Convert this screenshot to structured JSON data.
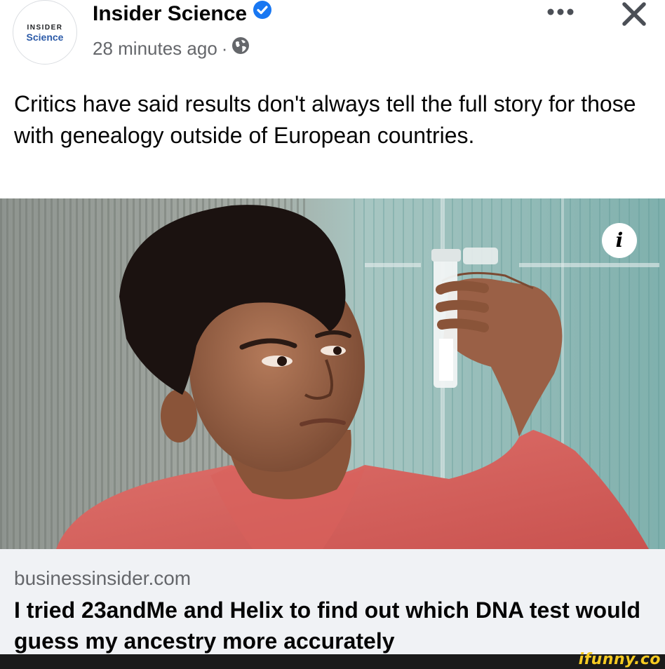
{
  "post": {
    "avatar": {
      "line1": "INSIDER",
      "line2": "Science"
    },
    "page_name": "Insider Science",
    "timestamp": "28 minutes ago",
    "separator": "·",
    "caption": "Critics have said results don't always tell the full story for those with genealogy outside of European countries.",
    "info_glyph": "i"
  },
  "link_preview": {
    "domain": "businessinsider.com",
    "headline": "I tried 23andMe and Helix to find out which DNA test would guess my ancestry more accurately"
  },
  "watermark": {
    "text": "ifunny.co"
  },
  "icons": [
    "verified-badge-icon",
    "globe-icon",
    "more-icon",
    "close-icon",
    "info-icon"
  ],
  "colors": {
    "verified": "#1877f2",
    "secondary_text": "#65676b",
    "link_bg": "#f0f2f5",
    "watermark": "#f6cb22"
  }
}
